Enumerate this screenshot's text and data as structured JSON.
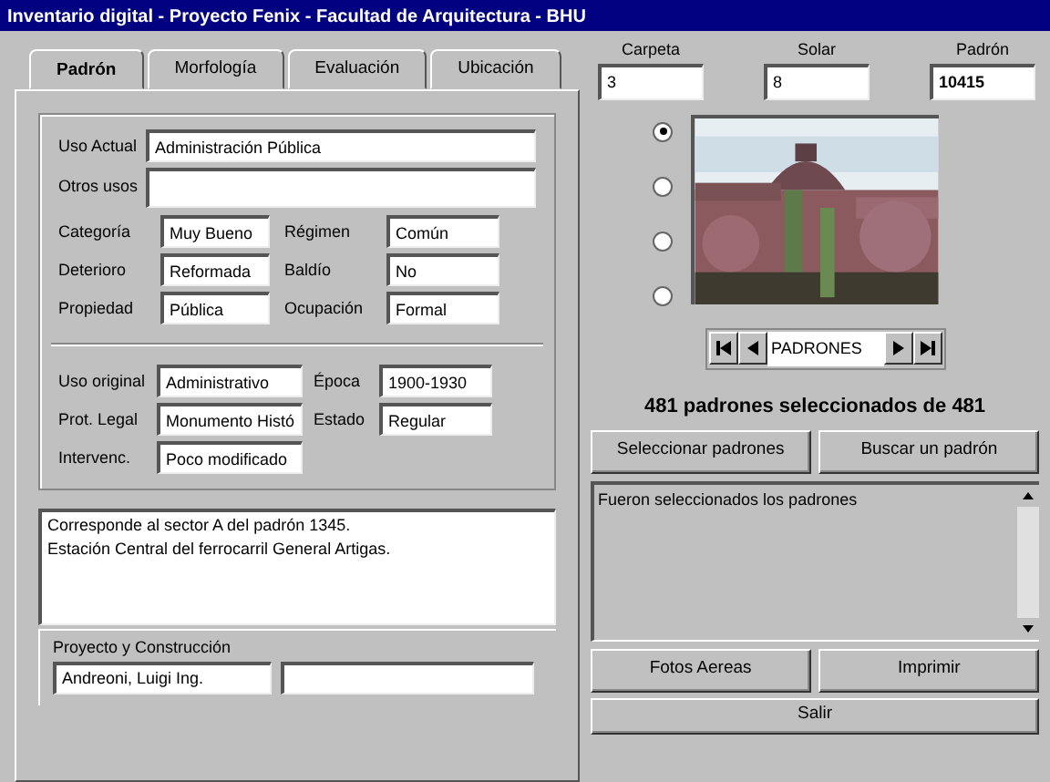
{
  "window": {
    "title": "Inventario digital - Proyecto Fenix - Facultad de Arquitectura - BHU"
  },
  "tabs": [
    {
      "label": "Padrón",
      "selected": true
    },
    {
      "label": "Morfología",
      "selected": false
    },
    {
      "label": "Evaluación",
      "selected": false
    },
    {
      "label": "Ubicación",
      "selected": false
    }
  ],
  "uso": {
    "uso_actual": {
      "label": "Uso Actual",
      "value": "Administración Pública"
    },
    "otros_usos": {
      "label": "Otros usos"
    }
  },
  "group_1": [
    {
      "label": "Categoría",
      "value": "Muy Bueno"
    },
    {
      "label": "Régimen",
      "value": "Común"
    },
    {
      "label": "Deterioro",
      "value": "Reformada"
    },
    {
      "label": "Baldío",
      "value": "No"
    },
    {
      "label": "Propiedad",
      "value": "Pública"
    },
    {
      "label": "Ocupación",
      "value": "Formal"
    }
  ],
  "group_2": [
    {
      "label": "Uso original",
      "value": "Administrativo"
    },
    {
      "label": "Época",
      "value": "1900-1930"
    },
    {
      "label": "Prot. Legal",
      "value": "Monumento Histó"
    },
    {
      "label": "Estado",
      "value": "Regular"
    },
    {
      "label": "Intervenc.",
      "value": "Poco modificado"
    }
  ],
  "notes": [
    "Corresponde al sector A del padrón 1345.",
    "Estación Central del ferrocarril General Artigas."
  ],
  "proyecto": {
    "label": "Proyecto y Construcción",
    "value": "Andreoni, Luigi Ing."
  },
  "ids": [
    {
      "label": "Carpeta",
      "value": "3"
    },
    {
      "label": "Solar",
      "value": "8"
    },
    {
      "label": "Padrón",
      "value": "10415"
    }
  ],
  "photo_options": [
    {
      "selected": true
    },
    {
      "selected": false
    },
    {
      "selected": false
    },
    {
      "selected": false
    }
  ],
  "navigator": {
    "label": "PADRONES"
  },
  "count_text": "481 padrones seleccionados de 481",
  "actions_1": [
    "Seleccionar padrones",
    "Buscar un padrón"
  ],
  "message": "Fueron seleccionados los padrones",
  "actions_2": [
    "Fotos Aereas",
    "Imprimir"
  ],
  "exit_button": "Salir"
}
